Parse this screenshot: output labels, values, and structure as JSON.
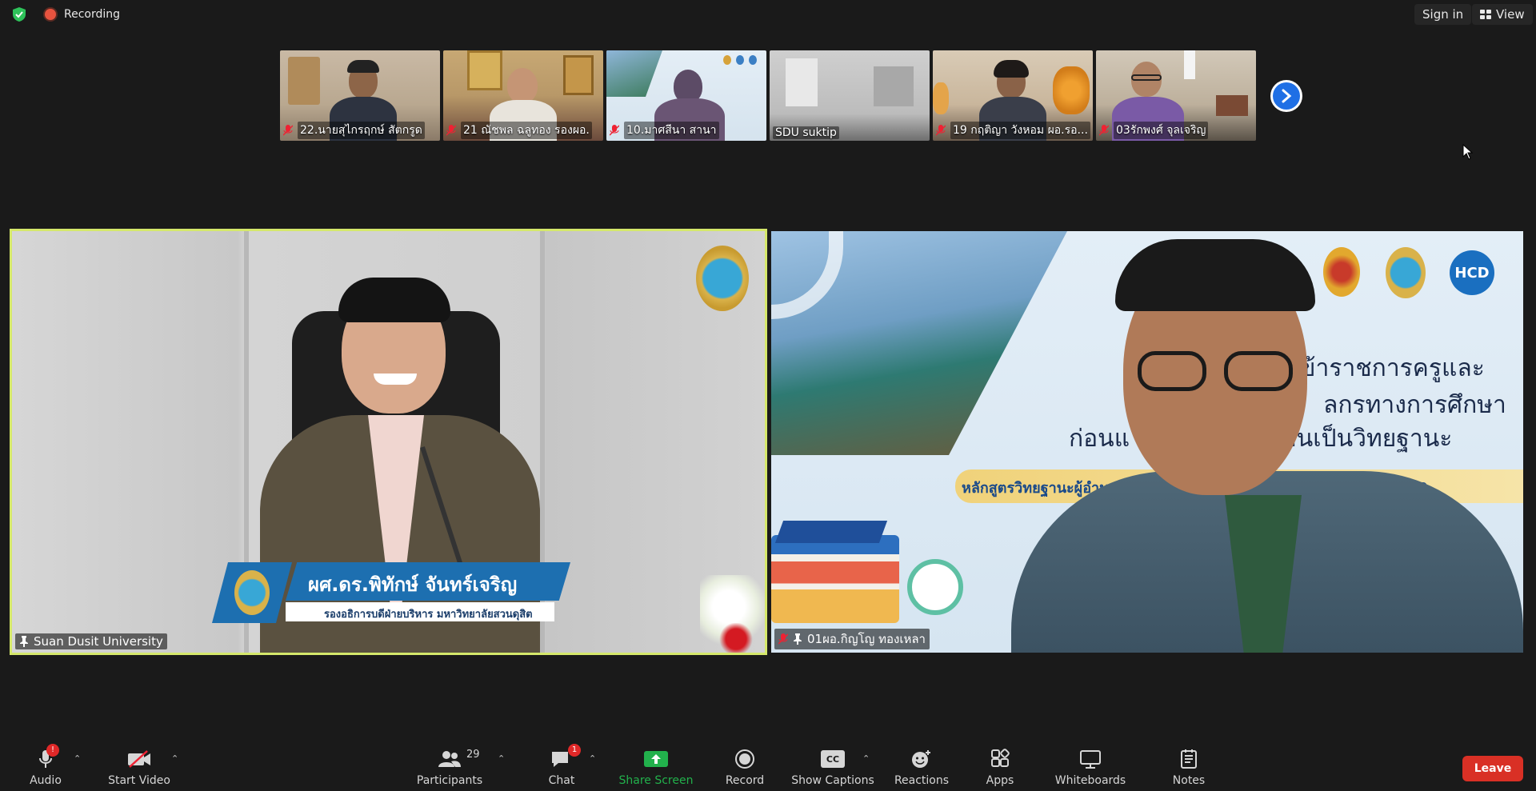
{
  "topbar": {
    "recording_label": "Recording",
    "signin_label": "Sign in",
    "view_label": "View"
  },
  "thumbnails": [
    {
      "name": "22.นายสุไกรฤกษ์ สัตกรูด",
      "muted": true
    },
    {
      "name": "21 ณัชพล ฉลูทอง รองผอ.",
      "muted": true
    },
    {
      "name": "10.มาศสีนา สานา",
      "muted": true
    },
    {
      "name": "SDU suktip",
      "muted": false
    },
    {
      "name": "19 กฤติญา วังหอม ผอ.รอ...",
      "muted": true
    },
    {
      "name": "03รักพงศ์ จุลเจริญ",
      "muted": true
    }
  ],
  "main_left": {
    "participant_name": "Suan Dusit University",
    "lower_third_name": "ผศ.ดร.พิทักษ์ จันทร์เจริญ",
    "lower_third_title": "รองอธิการบดีฝ่ายบริหาร มหาวิทยาลัยสวนดุสิต"
  },
  "main_right": {
    "participant_name": "01ผอ.กิญโญ ทองเหลา",
    "banner_line1": "ข้าราชการครูและ",
    "banner_line2": "ลกรทางการศึกษา",
    "banner_line3": "ก่อนแ                 เลื่อนเป็นวิทยฐานะ",
    "banner_course": "หลักสูตรวิทยฐานะผู้อำนวย                         ชการเชี่ยวชาญ ระยะที่ 140",
    "logo_text": "HCD"
  },
  "toolbar": {
    "audio_label": "Audio",
    "audio_badge": "!",
    "video_label": "Start Video",
    "participants_label": "Participants",
    "participants_count": "29",
    "chat_label": "Chat",
    "chat_badge": "1",
    "share_label": "Share Screen",
    "record_label": "Record",
    "captions_label": "Show Captions",
    "captions_icon_text": "CC",
    "reactions_label": "Reactions",
    "apps_label": "Apps",
    "whiteboards_label": "Whiteboards",
    "notes_label": "Notes",
    "leave_label": "Leave"
  },
  "colors": {
    "accent_blue": "#1f6fe5",
    "share_green": "#22b14c",
    "leave_red": "#d93025",
    "active_speaker_border": "#d5e86b"
  }
}
